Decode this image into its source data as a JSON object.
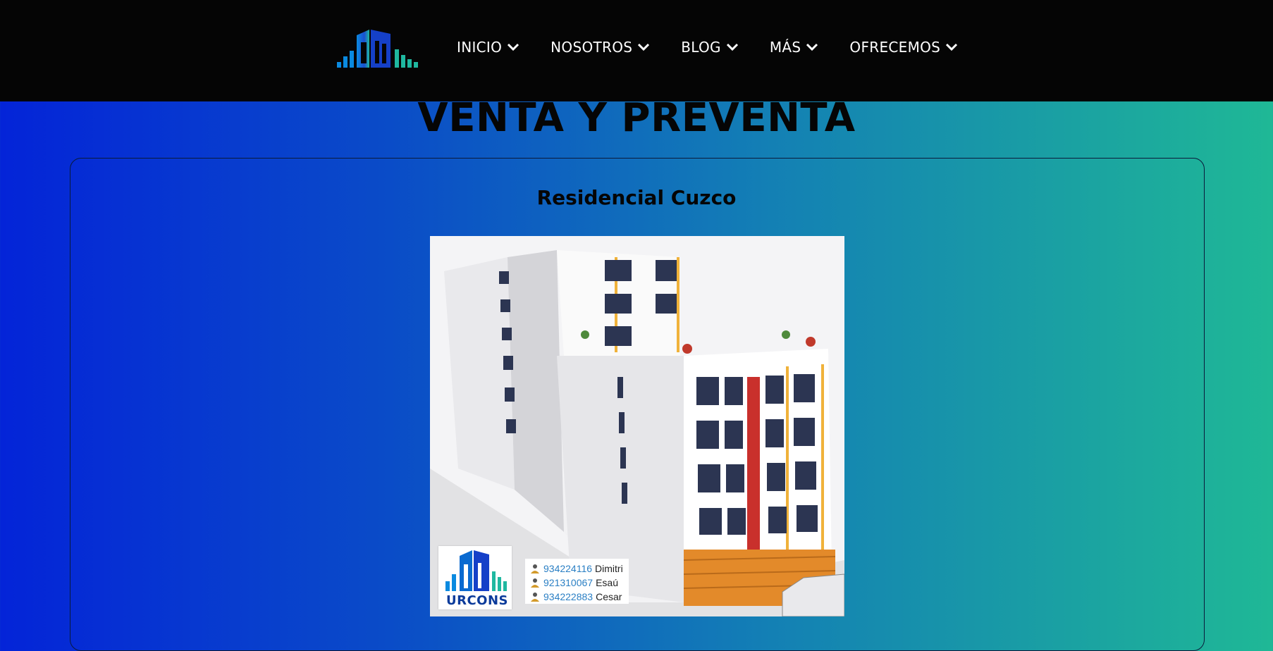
{
  "nav": {
    "logo_icon": "building-logo-icon",
    "items": [
      {
        "label": "INICIO",
        "icon": "chevron-down-icon"
      },
      {
        "label": "NOSOTROS",
        "icon": "chevron-down-icon"
      },
      {
        "label": "BLOG",
        "icon": "chevron-down-icon"
      },
      {
        "label": "MÁS",
        "icon": "chevron-down-icon"
      },
      {
        "label": "OFRECEMOS",
        "icon": "chevron-down-icon"
      }
    ]
  },
  "page": {
    "title": "VENTA Y PREVENTA"
  },
  "listing": {
    "title": "Residencial Cuzco",
    "image": {
      "logo_text": "URCONS",
      "contacts": [
        {
          "phone": "934224116",
          "name": "Dimitri"
        },
        {
          "phone": "921310067",
          "name": "Esaú"
        },
        {
          "phone": "934222883",
          "name": "Cesar"
        }
      ]
    }
  },
  "colors": {
    "nav_background": "#050505",
    "gradient_start": "#0424d8",
    "gradient_end": "#1fb896",
    "logo_blue": "#1a6fe0",
    "logo_teal": "#1fb8a0"
  }
}
